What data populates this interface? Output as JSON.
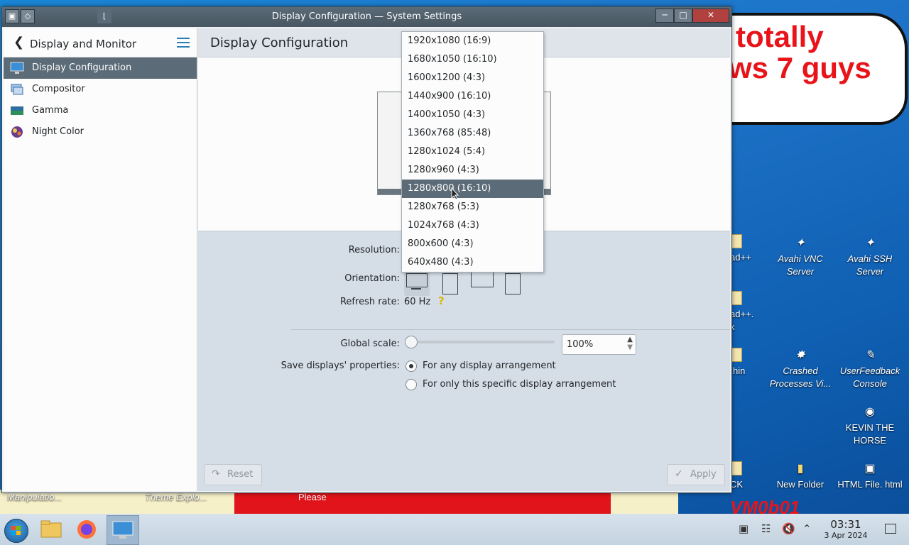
{
  "window": {
    "title": "Display Configuration — System Settings"
  },
  "sidebar": {
    "header_title": "Display and Monitor",
    "items": [
      {
        "label": "Display Configuration",
        "active": true
      },
      {
        "label": "Compositor"
      },
      {
        "label": "Gamma"
      },
      {
        "label": "Night Color"
      }
    ]
  },
  "content": {
    "title": "Display Configuration",
    "resolution_label": "Resolution:",
    "orientation_label": "Orientation:",
    "refresh_label": "Refresh rate:",
    "refresh_value": "60 Hz",
    "global_scale_label": "Global scale:",
    "global_scale_value": "100%",
    "save_label": "Save displays' properties:",
    "save_option_any": "For any display arrangement",
    "save_option_specific": "For only this specific display arrangement",
    "reset_label": "Reset",
    "apply_label": "Apply"
  },
  "dropdown": {
    "items": [
      "1920x1080 (16:9)",
      "1680x1050 (16:10)",
      "1600x1200 (4:3)",
      "1440x900 (16:10)",
      "1400x1050 (4:3)",
      "1360x768 (85:48)",
      "1280x1024 (5:4)",
      "1280x960 (4:3)",
      "1280x800 (16:10)",
      "1280x768 (5:3)",
      "1024x768 (4:3)",
      "800x600 (4:3)",
      "640x480 (4:3)"
    ],
    "highlighted": "1280x800 (16:10)"
  },
  "desktop": {
    "wallpaper_text_1": "totally",
    "wallpaper_text_2": "ws 7 guys",
    "wallpaper_please": "Please",
    "wallpaper_signature": "VM0b01",
    "icons": {
      "avahi_vnc": "Avahi VNC Server",
      "avahi_ssh": "Avahi SSH Server",
      "crashed": "Crashed Processes Vi...",
      "userfeedback": "UserFeedback Console",
      "kevin": "KEVIN THE HORSE",
      "new_folder": "New Folder",
      "html_file": "HTML File. html"
    },
    "partial": {
      "notepad1": "ad++",
      "notepad2": "ad++.",
      "notepad2b": "k",
      "chin": "hin",
      "ck": "CK",
      "manip": "Manipulatio...",
      "theme": "Theme Explo..."
    }
  },
  "taskbar": {
    "time": "03:31",
    "date": "3 Apr 2024"
  },
  "colors": {
    "accent": "#2980b9",
    "selection": "#5b6b77",
    "wallpaper_red": "#e0141a"
  }
}
